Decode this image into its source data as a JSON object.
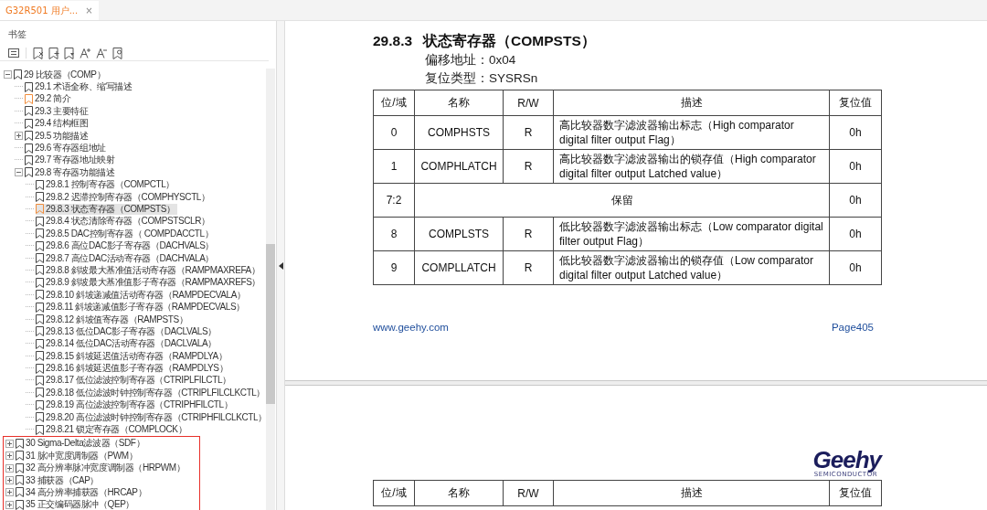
{
  "tab": {
    "title": "G32R501 用户...",
    "close": "×",
    "selected": true
  },
  "sidebar": {
    "title": "书签",
    "tree": [
      {
        "label": "29 比较器（COMP）",
        "expanded": true,
        "selected": false,
        "marked": false,
        "children": [
          {
            "label": "29.1 术语全称、缩写描述",
            "selected": false,
            "marked": false
          },
          {
            "label": "29.2 简介",
            "selected": false,
            "marked": true
          },
          {
            "label": "29.3 主要特征",
            "selected": false,
            "marked": false
          },
          {
            "label": "29.4 结构框图",
            "selected": false,
            "marked": false
          },
          {
            "label": "29.5 功能描述",
            "expanded": false,
            "selected": false,
            "marked": false
          },
          {
            "label": "29.6 寄存器组地址",
            "selected": false,
            "marked": false
          },
          {
            "label": "29.7 寄存器地址映射",
            "selected": false,
            "marked": false
          },
          {
            "label": "29.8 寄存器功能描述",
            "expanded": true,
            "selected": false,
            "marked": false,
            "children": [
              {
                "label": "29.8.1 控制寄存器（COMPCTL）",
                "selected": false,
                "marked": false
              },
              {
                "label": "29.8.2 迟滞控制寄存器（COMPHYSCTL）",
                "selected": false,
                "marked": false
              },
              {
                "label": "29.8.3 状态寄存器（COMPSTS）",
                "selected": true,
                "marked": true
              },
              {
                "label": "29.8.4 状态清除寄存器（COMPSTSCLR）",
                "selected": false,
                "marked": false
              },
              {
                "label": "29.8.5 DAC控制寄存器（ COMPDACCTL）",
                "selected": false,
                "marked": false
              },
              {
                "label": "29.8.6 高位DAC影子寄存器（DACHVALS）",
                "selected": false,
                "marked": false
              },
              {
                "label": "29.8.7 高位DAC活动寄存器（DACHVALA）",
                "selected": false,
                "marked": false
              },
              {
                "label": "29.8.8 斜坡最大基准值活动寄存器（RAMPMAXREFA）",
                "selected": false,
                "marked": false
              },
              {
                "label": "29.8.9 斜坡最大基准值影子寄存器（RAMPMAXREFS）",
                "selected": false,
                "marked": false
              },
              {
                "label": "29.8.10 斜坡递减值活动寄存器（RAMPDECVALA）",
                "selected": false,
                "marked": false
              },
              {
                "label": "29.8.11 斜坡递减值影子寄存器（RAMPDECVALS）",
                "selected": false,
                "marked": false
              },
              {
                "label": "29.8.12 斜坡值寄存器（RAMPSTS）",
                "selected": false,
                "marked": false
              },
              {
                "label": "29.8.13 低位DAC影子寄存器（DACLVALS）",
                "selected": false,
                "marked": false
              },
              {
                "label": "29.8.14 低位DAC活动寄存器（DACLVALA）",
                "selected": false,
                "marked": false
              },
              {
                "label": "29.8.15 斜坡延迟值活动寄存器（RAMPDLYA）",
                "selected": false,
                "marked": false
              },
              {
                "label": "29.8.16 斜坡延迟值影子寄存器（RAMPDLYS）",
                "selected": false,
                "marked": false
              },
              {
                "label": "29.8.17 低位滤波控制寄存器（CTRIPLFILCTL）",
                "selected": false,
                "marked": false
              },
              {
                "label": "29.8.18 低位滤波时钟控制寄存器（CTRIPLFILCLKCTL）",
                "selected": false,
                "marked": false
              },
              {
                "label": "29.8.19 高位滤波控制寄存器（CTRIPHFILCTL）",
                "selected": false,
                "marked": false
              },
              {
                "label": "29.8.20 高位滤波时钟控制寄存器（CTRIPHFILCLKCTL）",
                "selected": false,
                "marked": false
              },
              {
                "label": "29.8.21 锁定寄存器（COMPLOCK）",
                "selected": false,
                "marked": false
              }
            ]
          }
        ]
      }
    ],
    "framed_items": [
      {
        "label": "30 Sigma-Delta滤波器（SDF）",
        "expanded": false,
        "selected": false,
        "marked": false
      },
      {
        "label": "31 脉冲宽度调制器（PWM）",
        "expanded": false,
        "selected": false,
        "marked": false
      },
      {
        "label": "32 高分辨率脉冲宽度调制器（HRPWM）",
        "expanded": false,
        "selected": false,
        "marked": false
      },
      {
        "label": "33 捕获器（CAP）",
        "expanded": false,
        "selected": false,
        "marked": false
      },
      {
        "label": "34 高分辨率捕获器（HRCAP）",
        "expanded": false,
        "selected": false,
        "marked": false
      },
      {
        "label": "35 正交编码器脉冲（QEP）",
        "expanded": false,
        "selected": false,
        "marked": false
      }
    ]
  },
  "page1": {
    "section_number": "29.8.3",
    "section_title": "状态寄存器（COMPSTS）",
    "meta": [
      "偏移地址：0x04",
      "复位类型：SYSRSn"
    ],
    "columns": [
      "位/域",
      "名称",
      "R/W",
      "描述",
      "复位值"
    ],
    "rows": [
      {
        "kind": "field",
        "bits": "0",
        "name": "COMPHSTS",
        "rw": "R",
        "description": "高比较器数字滤波器输出标志（High comparator digital filter output Flag）",
        "reset": "0h"
      },
      {
        "kind": "field",
        "bits": "1",
        "name": "COMPHLATCH",
        "rw": "R",
        "description": "高比较器数字滤波器输出的锁存值（High comparator digital filter output Latched value）",
        "reset": "0h"
      },
      {
        "kind": "reserved",
        "bits": "7:2",
        "description": "保留",
        "reset": "0h"
      },
      {
        "kind": "field",
        "bits": "8",
        "name": "COMPLSTS",
        "rw": "R",
        "description": "低比较器数字滤波器输出标志（Low comparator digital filter output Flag）",
        "reset": "0h"
      },
      {
        "kind": "field",
        "bits": "9",
        "name": "COMPLLATCH",
        "rw": "R",
        "description": "低比较器数字滤波器输出的锁存值（Low comparator digital filter output Latched value）",
        "reset": "0h"
      }
    ],
    "footer_link": "www.geehy.com",
    "page_number": "Page405"
  },
  "page2": {
    "logo": "Geehy",
    "logo_tagline": "SEMICONDUCTOR",
    "columns": [
      "位/域",
      "名称",
      "R/W",
      "描述",
      "复位值"
    ]
  }
}
